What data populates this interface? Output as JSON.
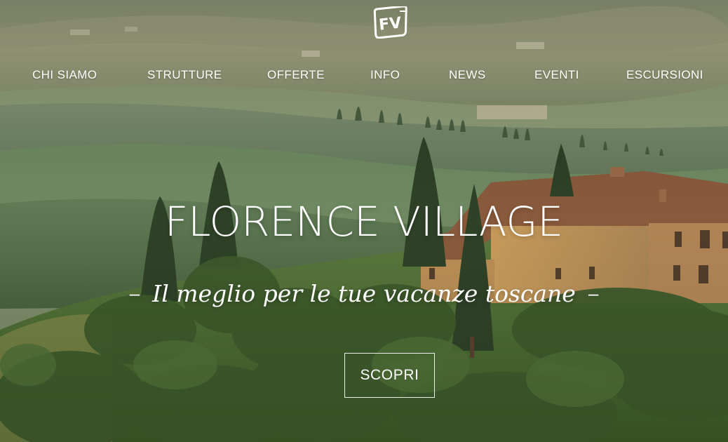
{
  "brand": {
    "logo_text": "FV",
    "logo_icon": "fv-logo-icon"
  },
  "nav": {
    "items": [
      {
        "label": "CHI SIAMO"
      },
      {
        "label": "STRUTTURE"
      },
      {
        "label": "OFFERTE"
      },
      {
        "label": "INFO"
      },
      {
        "label": "NEWS"
      },
      {
        "label": "EVENTI"
      },
      {
        "label": "ESCURSIONI"
      }
    ]
  },
  "hero": {
    "title": "FLORENCE VILLAGE",
    "subtitle": "Il meglio per le tue vacanze toscane",
    "dash": "–",
    "cta_label": "SCOPRI",
    "background": "tuscan-countryside-villa-photo"
  },
  "colors": {
    "text": "#ffffff"
  }
}
